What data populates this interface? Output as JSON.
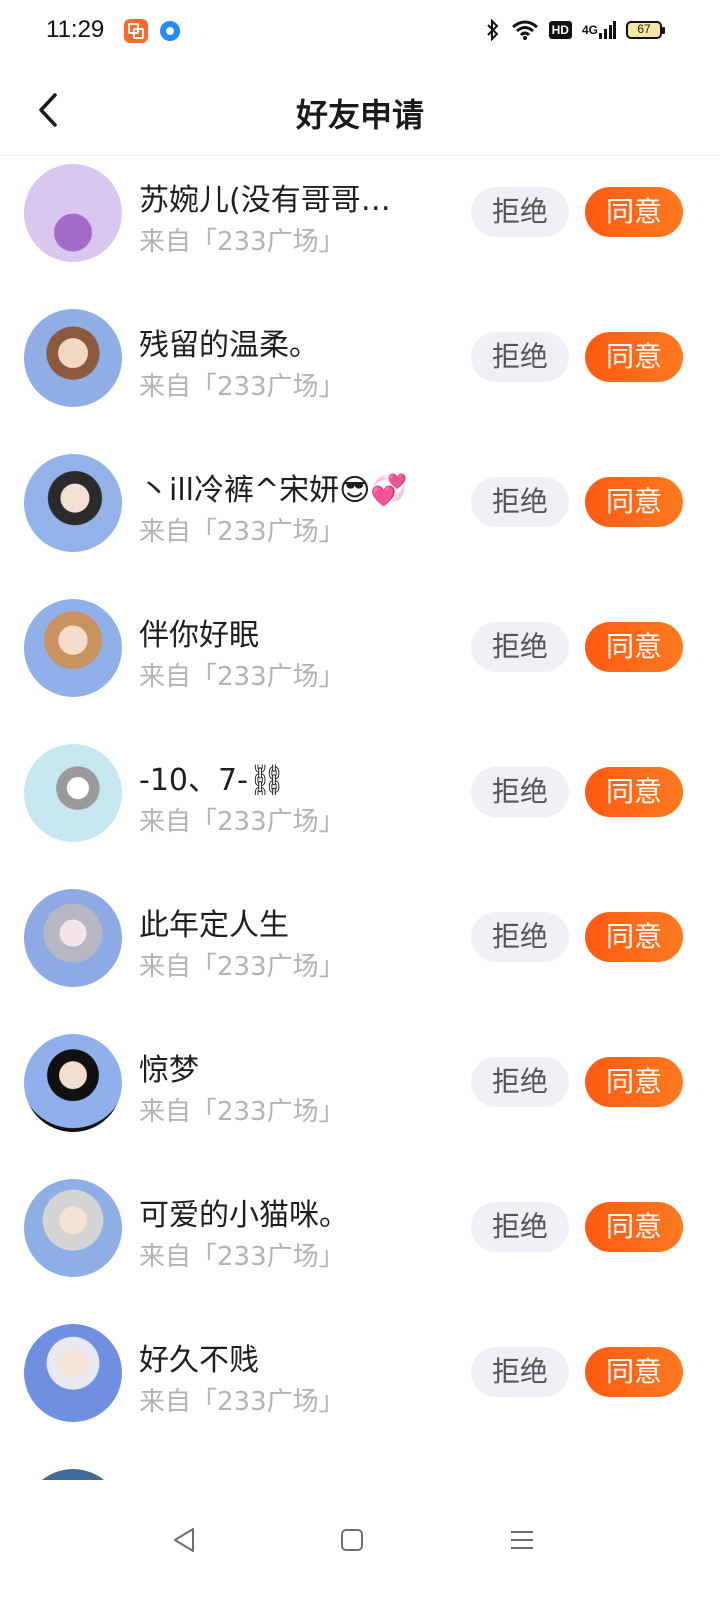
{
  "status_bar": {
    "time": "11:29",
    "network_label": "4G",
    "hd_label": "HD",
    "battery_level": "67"
  },
  "header": {
    "title": "好友申请"
  },
  "colors": {
    "accent": "#ff6414",
    "reject_bg": "#eef0f5",
    "source_text": "#b3b3b3"
  },
  "requests": [
    {
      "name": "苏婉儿(没有哥哥…",
      "source": "来自「233广场」",
      "reject_label": "拒绝",
      "accept_label": "同意",
      "avatar_color": "#d9c7ef"
    },
    {
      "name": "残留的温柔。",
      "source": "来自「233广场」",
      "reject_label": "拒绝",
      "accept_label": "同意",
      "avatar_color": "#8faee6"
    },
    {
      "name": "丶ill冷裤^宋妍😎💞",
      "source": "来自「233广场」",
      "reject_label": "拒绝",
      "accept_label": "同意",
      "avatar_color": "#93b2ea"
    },
    {
      "name": "伴你好眠",
      "source": "来自「233广场」",
      "reject_label": "拒绝",
      "accept_label": "同意",
      "avatar_color": "#8fb0e8"
    },
    {
      "name": "-10、7-⛓",
      "source": "来自「233广场」",
      "reject_label": "拒绝",
      "accept_label": "同意",
      "avatar_color": "#c6e6f0"
    },
    {
      "name": "此年定人生",
      "source": "来自「233广场」",
      "reject_label": "拒绝",
      "accept_label": "同意",
      "avatar_color": "#8daae4"
    },
    {
      "name": "惊梦",
      "source": "来自「233广场」",
      "reject_label": "拒绝",
      "accept_label": "同意",
      "avatar_color": "#8fb0ea"
    },
    {
      "name": "可爱的小猫咪。",
      "source": "来自「233广场」",
      "reject_label": "拒绝",
      "accept_label": "同意",
      "avatar_color": "#8eaee6"
    },
    {
      "name": "好久不贱",
      "source": "来自「233广场」",
      "reject_label": "拒绝",
      "accept_label": "同意",
      "avatar_color": "#6f90e0"
    }
  ],
  "nav": {
    "back_icon": "triangle-back-icon",
    "home_icon": "square-home-icon",
    "menu_icon": "hamburger-menu-icon"
  }
}
